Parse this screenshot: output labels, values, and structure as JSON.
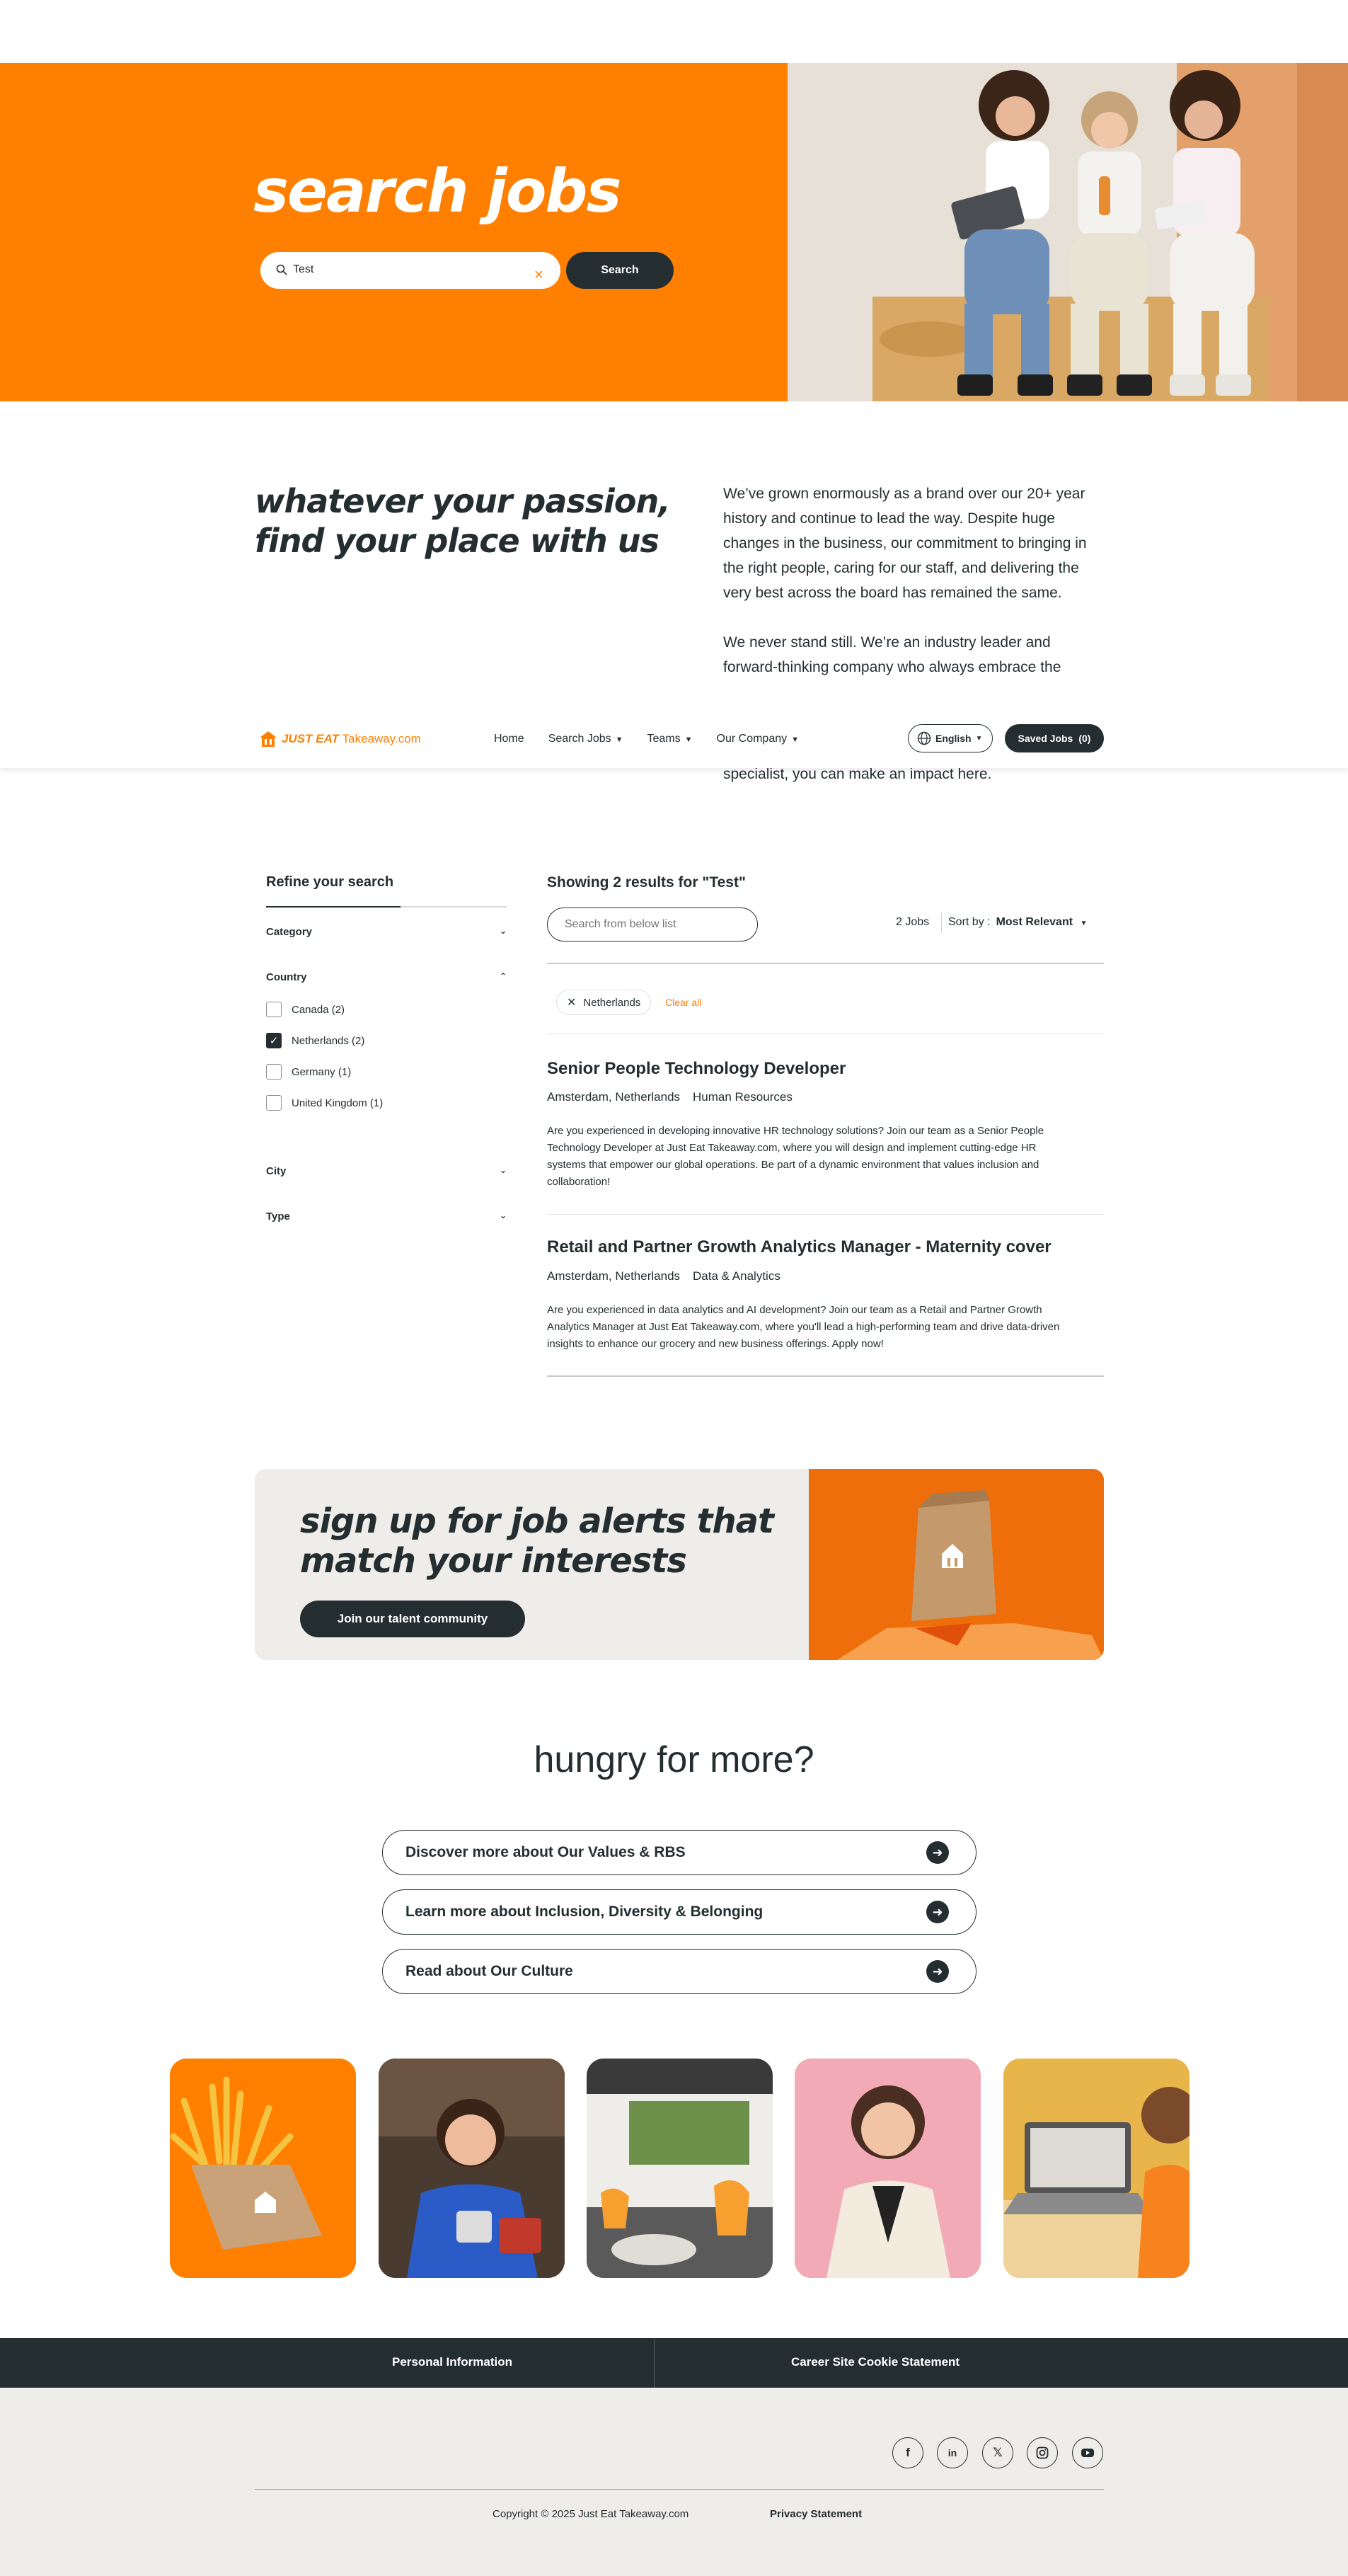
{
  "hero": {
    "title": "search jobs",
    "search_value": "Test",
    "clear_symbol": "×",
    "search_button": "Search",
    "search_icon": "search-icon"
  },
  "intro": {
    "heading_line1": "whatever your passion,",
    "heading_line2": "find your place with us",
    "para1": "We’ve grown enormously as a brand over our 20+ year history and continue to lead the way. Despite huge changes in the business, our commitment to bringing in the right people, caring for our staff, and delivering the very best across the board has remained the same.",
    "para2": "We never stand still. We’re an industry leader and forward-thinking company who always embrace the",
    "para3_tail": "specialist, you can make an impact here."
  },
  "nav": {
    "logo_bold": "JUST EAT",
    "logo_rest": "Takeaway",
    "logo_suffix": ".com",
    "links": [
      "Home",
      "Search Jobs",
      "Teams",
      "Our Company"
    ],
    "language": "English",
    "saved_label": "Saved Jobs",
    "saved_count": "(0)",
    "accent": "#ff8000"
  },
  "filters": {
    "title": "Refine your search",
    "category": "Category",
    "country": "Country",
    "countries": [
      {
        "label": "Canada (2)",
        "checked": false
      },
      {
        "label": "Netherlands (2)",
        "checked": true
      },
      {
        "label": "Germany (1)",
        "checked": false
      },
      {
        "label": "United Kingdom (1)",
        "checked": false
      }
    ],
    "city": "City",
    "type": "Type"
  },
  "results": {
    "heading": "Showing 2 results for \"Test\"",
    "search_placeholder": "Search from below list",
    "count": "2 Jobs",
    "sort_label": "Sort by :",
    "sort_value": "Most Relevant",
    "active_filter": "Netherlands",
    "clear_all": "Clear all",
    "jobs": [
      {
        "title": "Senior People Technology Developer",
        "location": "Amsterdam, Netherlands",
        "department": "Human Resources",
        "description": "Are you experienced in developing innovative HR technology solutions? Join our team as a Senior People Technology Developer at Just Eat Takeaway.com, where you will design and implement cutting-edge HR systems that empower our global operations. Be part of a dynamic environment that values inclusion and collaboration!"
      },
      {
        "title": "Retail and Partner Growth Analytics Manager - Maternity cover",
        "location": "Amsterdam, Netherlands",
        "department": "Data & Analytics",
        "description": "Are you experienced in data analytics and AI development? Join our team as a Retail and Partner Growth Analytics Manager at Just Eat Takeaway.com, where you'll lead a high-performing team and drive data-driven insights to enhance our grocery and new business offerings. Apply now!"
      }
    ]
  },
  "alert": {
    "heading_line1": "sign up for job alerts that",
    "heading_line2": "match your interests",
    "button": "Join our talent community"
  },
  "more": {
    "heading": "hungry for more?",
    "links": [
      "Discover more about Our Values & RBS",
      "Learn more about Inclusion, Diversity & Belonging",
      "Read about Our Culture"
    ]
  },
  "footer": {
    "personal_info": "Personal Information",
    "cookie": "Career Site Cookie Statement",
    "social_icons": [
      "facebook-icon",
      "linkedin-icon",
      "x-icon",
      "instagram-icon",
      "youtube-icon"
    ],
    "copyright": "Copyright © 2025 Just Eat Takeaway.com",
    "privacy": "Privacy Statement"
  }
}
